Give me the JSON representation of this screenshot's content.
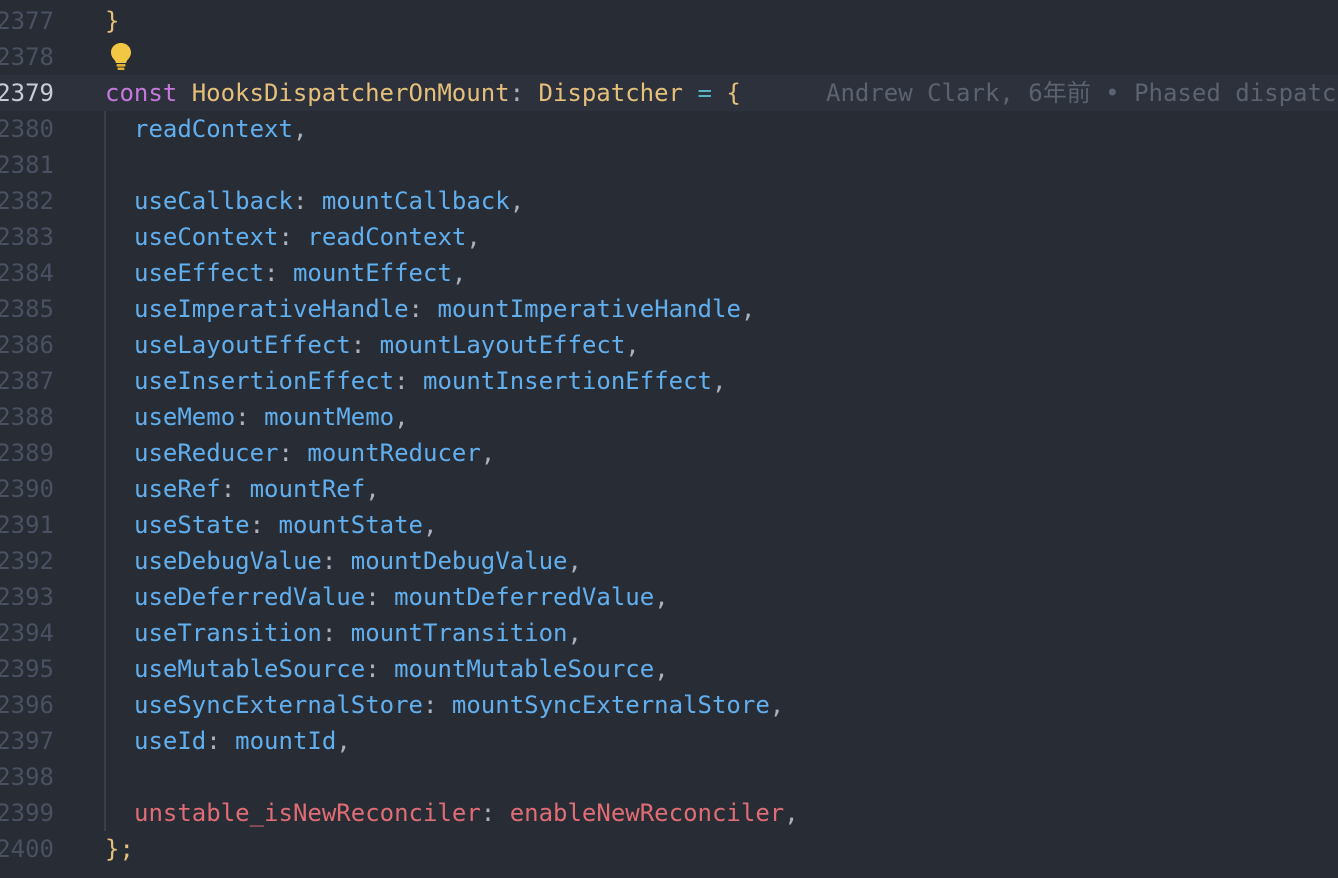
{
  "colors": {
    "background": "#282c34",
    "keyword": "#c678dd",
    "type": "#e5c07b",
    "operator": "#56b6c2",
    "property": "#61afef",
    "flag": "#e06c75",
    "blame": "#5c6370",
    "lightbulb": "#f2c744"
  },
  "line_numbers": [
    "2377",
    "2378",
    "2379",
    "2380",
    "2381",
    "2382",
    "2383",
    "2384",
    "2385",
    "2386",
    "2387",
    "2388",
    "2389",
    "2390",
    "2391",
    "2392",
    "2393",
    "2394",
    "2395",
    "2396",
    "2397",
    "2398",
    "2399",
    "2400"
  ],
  "code": {
    "l2377": {
      "brace": "}"
    },
    "l2379": {
      "keyword": "const",
      "name": "HooksDispatcherOnMount",
      "colon": ":",
      "type": "Dispatcher",
      "equals": "=",
      "brace": "{",
      "blame": "Andrew Clark, 6年前 • Phased dispatc"
    },
    "l2380": {
      "prop": "readContext",
      "comma": ","
    },
    "entries": [
      {
        "key": "useCallback",
        "value": "mountCallback"
      },
      {
        "key": "useContext",
        "value": "readContext"
      },
      {
        "key": "useEffect",
        "value": "mountEffect"
      },
      {
        "key": "useImperativeHandle",
        "value": "mountImperativeHandle"
      },
      {
        "key": "useLayoutEffect",
        "value": "mountLayoutEffect"
      },
      {
        "key": "useInsertionEffect",
        "value": "mountInsertionEffect"
      },
      {
        "key": "useMemo",
        "value": "mountMemo"
      },
      {
        "key": "useReducer",
        "value": "mountReducer"
      },
      {
        "key": "useRef",
        "value": "mountRef"
      },
      {
        "key": "useState",
        "value": "mountState"
      },
      {
        "key": "useDebugValue",
        "value": "mountDebugValue"
      },
      {
        "key": "useDeferredValue",
        "value": "mountDeferredValue"
      },
      {
        "key": "useTransition",
        "value": "mountTransition"
      },
      {
        "key": "useMutableSource",
        "value": "mountMutableSource"
      },
      {
        "key": "useSyncExternalStore",
        "value": "mountSyncExternalStore"
      },
      {
        "key": "useId",
        "value": "mountId"
      }
    ],
    "l2399": {
      "key": "unstable_isNewReconciler",
      "value": "enableNewReconciler"
    },
    "l2400": {
      "close": "};"
    },
    "colon": ": ",
    "comma": ","
  },
  "icons": {
    "lightbulb": "lightbulb-icon"
  }
}
